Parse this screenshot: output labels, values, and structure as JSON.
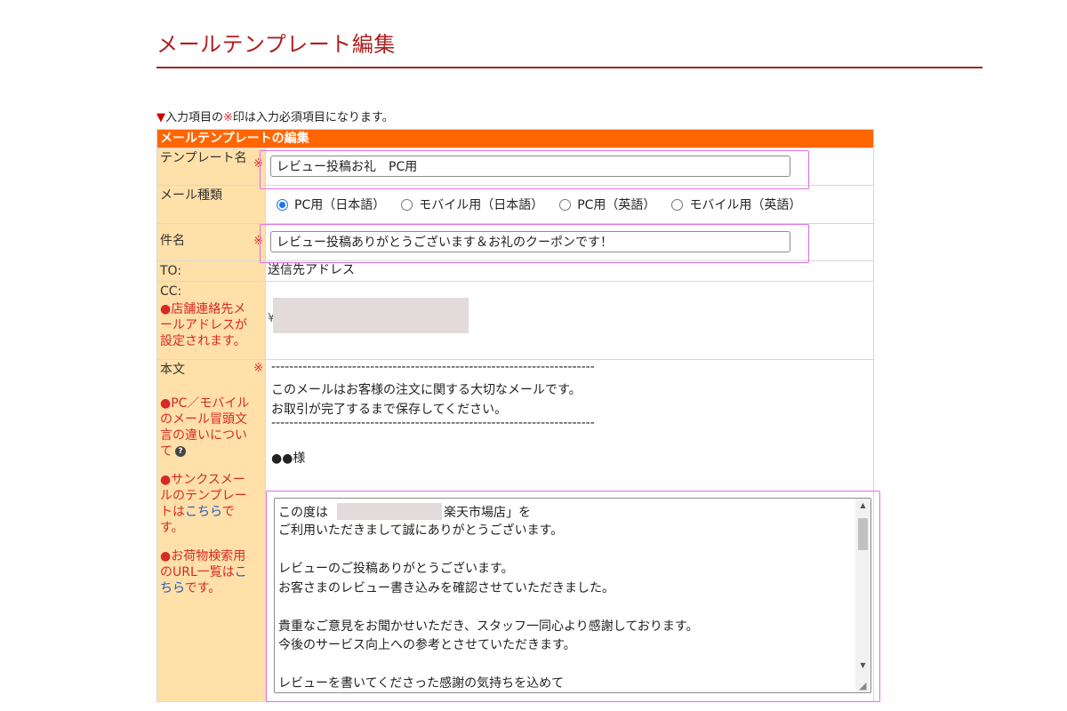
{
  "page": {
    "title": "メールテンプレート編集",
    "notice_triangle": "▼",
    "notice_prefix": "入力項目の",
    "notice_mark": "※",
    "notice_suffix": "印は入力必須項目になります。"
  },
  "form": {
    "header": "メールテンプレートの編集",
    "required_mark": "※",
    "template_name": {
      "label": "テンプレート名",
      "value": "レビュー投稿お礼　PC用"
    },
    "mail_type": {
      "label": "メール種類",
      "options": [
        {
          "label": "PC用（日本語）",
          "checked": true
        },
        {
          "label": "モバイル用（日本語）",
          "checked": false
        },
        {
          "label": "PC用（英語）",
          "checked": false
        },
        {
          "label": "モバイル用（英語）",
          "checked": false
        }
      ]
    },
    "subject": {
      "label": "件名",
      "value": "レビュー投稿ありがとうございます＆お礼のクーポンです！"
    },
    "to": {
      "label": "TO:",
      "value": "送信先アドレス"
    },
    "cc": {
      "label": "CC:",
      "note": "●店舗連絡先メールアドレスが設定されます。",
      "value_fragment": "¥"
    },
    "body": {
      "label": "本文",
      "note1": "●PC／モバイルのメール冒頭文言の違いについて",
      "help_icon": "?",
      "note2_prefix": "●サンクスメールのテンプレートは",
      "note2_link": "こちら",
      "note2_suffix": "です。",
      "note3_prefix": "●お荷物検索用のURL一覧は",
      "note3_link": "こちら",
      "note3_suffix": "です。",
      "header_lines": [
        "------------------------------------------------------------------------",
        "このメールはお客様の注文に関する大切なメールです。",
        "お取引が完了するまで保存してください。",
        "------------------------------------------------------------------------",
        "●●様"
      ],
      "textarea_lines": [
        "この度は",
        "楽天市場店」を",
        "ご利用いただきまして誠にありがとうございます。",
        "レビューのご投稿ありがとうございます。",
        "お客さまのレビュー書き込みを確認させていただきました。",
        "貴重なご意見をお聞かせいただき、スタッフ一同心より感謝しております。",
        "今後のサービス向上への参考とさせていただきます。",
        "レビューを書いてくださった感謝の気持ちを込めて"
      ]
    }
  },
  "icons": {
    "scroll_up": "▲",
    "scroll_down": "▼",
    "resize": "◢"
  }
}
